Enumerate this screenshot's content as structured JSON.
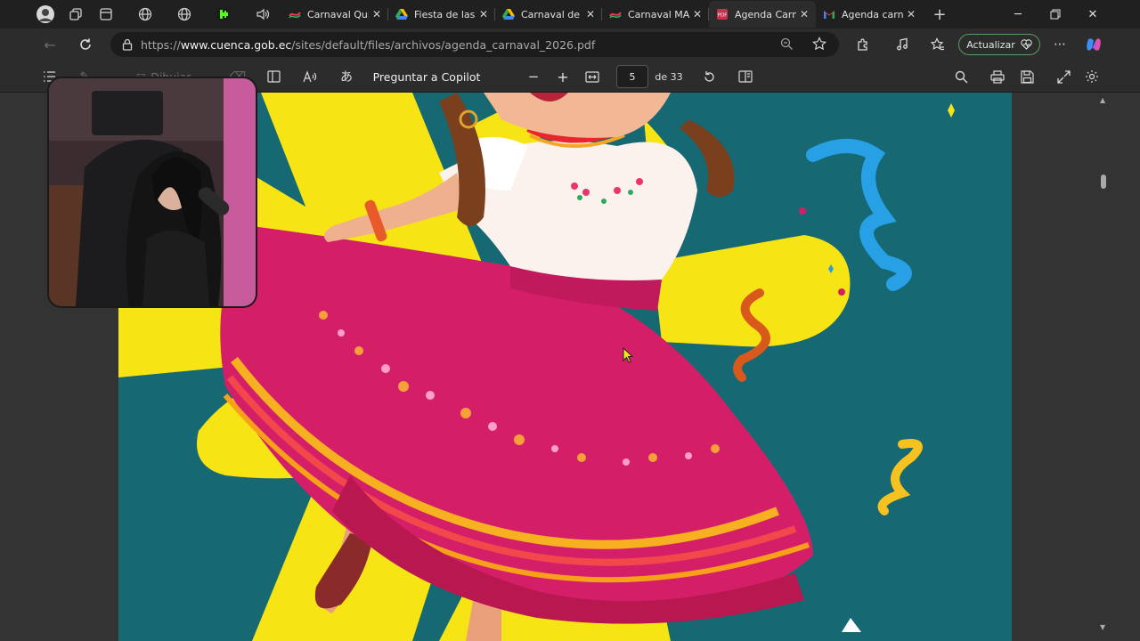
{
  "tabs": [
    {
      "label": "Carnaval Qui",
      "icon": "ribbon-icon"
    },
    {
      "label": "Fiesta de las",
      "icon": "google-drive-icon"
    },
    {
      "label": "Carnaval de C",
      "icon": "google-drive-icon"
    },
    {
      "label": "Carnaval MA",
      "icon": "ribbon-icon"
    },
    {
      "label": "Agenda Carn",
      "icon": "pdf-icon",
      "active": true
    },
    {
      "label": "Agenda carn",
      "icon": "gmail-icon"
    }
  ],
  "address": {
    "url_prefix": "https://",
    "url_domain": "www.cuenca.gob.ec",
    "url_path": "/sites/default/files/archivos/agenda_carnaval_2026.pdf",
    "update_label": "Actualizar"
  },
  "pdf_toolbar": {
    "draw_label": "Dibujar",
    "copilot_label": "Preguntar a Copilot",
    "page_number": "5",
    "page_total": "de 33"
  },
  "colors": {
    "page_bg": "#166873",
    "burst_yellow": "#f7e414",
    "skirt_pink": "#d41f68",
    "update_border": "#5d9b5d"
  }
}
